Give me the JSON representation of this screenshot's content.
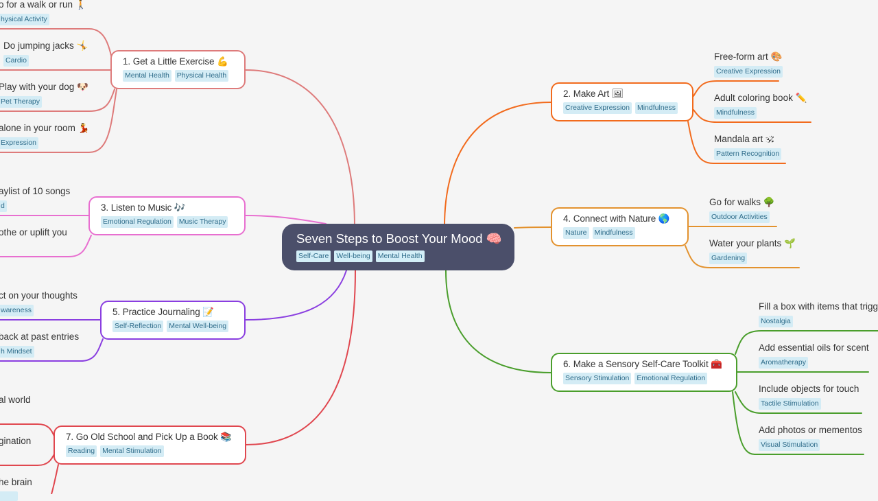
{
  "root": {
    "title": "Seven Steps to Boost Your Mood 🧠",
    "tags": [
      "Self-Care",
      "Well-being",
      "Mental Health"
    ],
    "color": "#4b4f6a"
  },
  "branches": [
    {
      "id": "exercise",
      "title": "1. Get a Little Exercise 💪",
      "tags": [
        "Mental Health",
        "Physical Health"
      ],
      "color": "#de7b7b",
      "children": [
        {
          "title": "o for a walk or run 🚶",
          "tags": [
            "hysical Activity"
          ]
        },
        {
          "title": "Do jumping jacks 🤸",
          "tags": [
            "Cardio"
          ]
        },
        {
          "title": "Play with your dog 🐶",
          "tags": [
            "Pet Therapy"
          ]
        },
        {
          "title": "alone in your room 💃",
          "tags": [
            "Expression"
          ]
        }
      ]
    },
    {
      "id": "art",
      "title": "2. Make Art 🖼",
      "tags": [
        "Creative Expression",
        "Mindfulness"
      ],
      "color": "#f26b1d",
      "children": [
        {
          "title": "Free-form art 🎨",
          "tags": [
            "Creative Expression"
          ]
        },
        {
          "title": "Adult coloring book ✏️",
          "tags": [
            "Mindfulness"
          ]
        },
        {
          "title": "Mandala art 🕉",
          "tags": [
            "Pattern Recognition"
          ]
        }
      ]
    },
    {
      "id": "music",
      "title": "3. Listen to Music 🎶",
      "tags": [
        "Emotional Regulation",
        "Music Therapy"
      ],
      "color": "#e86fd0",
      "children": [
        {
          "title": "aylist of 10 songs",
          "tags": [
            "d"
          ]
        },
        {
          "title": "othe or uplift you",
          "tags": []
        }
      ]
    },
    {
      "id": "nature",
      "title": "4. Connect with Nature 🌎",
      "tags": [
        "Nature",
        "Mindfulness"
      ],
      "color": "#e3922e",
      "children": [
        {
          "title": "Go for walks 🌳",
          "tags": [
            "Outdoor Activities"
          ]
        },
        {
          "title": "Water your plants 🌱",
          "tags": [
            "Gardening"
          ]
        }
      ]
    },
    {
      "id": "journaling",
      "title": "5. Practice Journaling 📝",
      "tags": [
        "Self-Reflection",
        "Mental Well-being"
      ],
      "color": "#8a3ee0",
      "children": [
        {
          "title": "ct on your thoughts",
          "tags": [
            "wareness"
          ]
        },
        {
          "title": "back at past entries",
          "tags": [
            "h Mindset"
          ]
        }
      ]
    },
    {
      "id": "toolkit",
      "title": "6. Make a Sensory Self-Care Toolkit 🧰",
      "tags": [
        "Sensory Stimulation",
        "Emotional Regulation"
      ],
      "color": "#4a9e2c",
      "children": [
        {
          "title": "Fill a box with items that trigg",
          "tags": [
            "Nostalgia"
          ]
        },
        {
          "title": "Add essential oils for scent",
          "tags": [
            "Aromatherapy"
          ]
        },
        {
          "title": "Include objects for touch",
          "tags": [
            "Tactile Stimulation"
          ]
        },
        {
          "title": "Add photos or mementos",
          "tags": [
            "Visual Stimulation"
          ]
        }
      ]
    },
    {
      "id": "book",
      "title": "7. Go Old School and Pick Up a Book 📚",
      "tags": [
        "Reading",
        "Mental Stimulation"
      ],
      "color": "#e0474f",
      "children": [
        {
          "title": "al world",
          "tags": []
        },
        {
          "title": "gination",
          "tags": []
        },
        {
          "title": "he brain",
          "tags": [
            ""
          ]
        }
      ]
    }
  ]
}
